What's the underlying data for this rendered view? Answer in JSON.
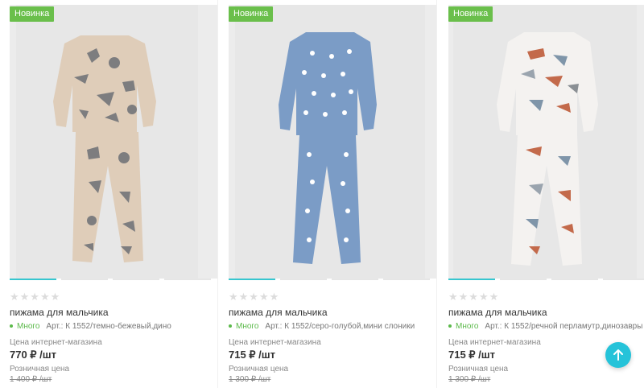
{
  "products": [
    {
      "badge": "Новинка",
      "name": "пижама для мальчика",
      "stock": "Много",
      "article": "Арт.: К 1552/темно-бежевый,дино",
      "online_price_label": "Цена интернет-магазина",
      "price": "770 ₽ /шт",
      "retail_price_label": "Розничная цена",
      "old_price": "1 400 ₽ /шт",
      "rating": "★★★★★",
      "fabric_color": "#dfcdb9",
      "print_color": "#7d7d7f"
    },
    {
      "badge": "Новинка",
      "name": "пижама для мальчика",
      "stock": "Много",
      "article": "Арт.: К 1552/серо-голубой,мини слоники",
      "online_price_label": "Цена интернет-магазина",
      "price": "715 ₽ /шт",
      "retail_price_label": "Розничная цена",
      "old_price": "1 300 ₽ /шт",
      "rating": "★★★★★",
      "fabric_color": "#7b9cc6",
      "print_color": "#ffffff"
    },
    {
      "badge": "Новинка",
      "name": "пижама для мальчика",
      "stock": "Много",
      "article": "Арт.: К 1552/речной перламутр,динозавры",
      "online_price_label": "Цена интернет-магазина",
      "price": "715 ₽ /шт",
      "retail_price_label": "Розничная цена",
      "old_price": "1 300 ₽ /шт",
      "rating": "★★★★★",
      "fabric_color": "#f4f2f0",
      "print_color": "#c36a4b"
    }
  ],
  "colors": {
    "accent": "#25c3d9",
    "badge": "#6abf4b",
    "in_stock": "#5bb94a"
  },
  "icons": {
    "scroll_top": "arrow-up-icon",
    "rating": "star-icon",
    "stock": "dot-icon"
  }
}
